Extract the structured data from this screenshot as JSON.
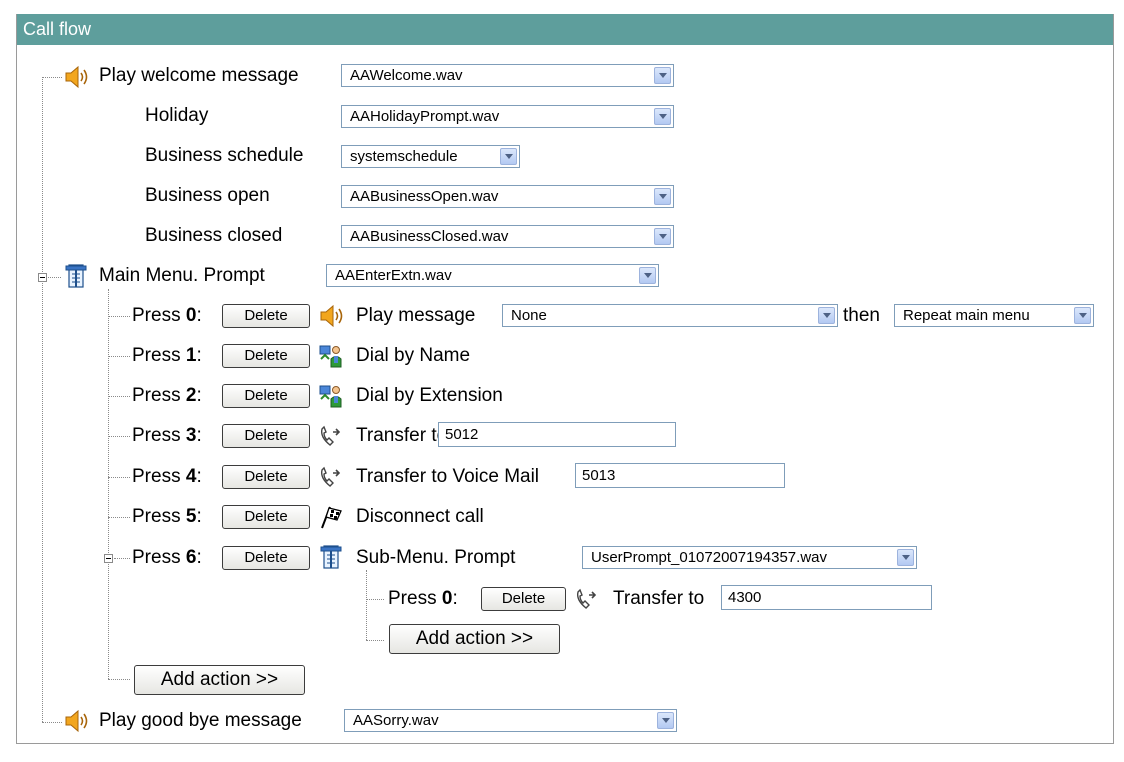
{
  "panel": {
    "title": "Call flow"
  },
  "welcome": {
    "label": "Play welcome message",
    "value": "AAWelcome.wav",
    "holiday_label": "Holiday",
    "holiday_value": "AAHolidayPrompt.wav",
    "schedule_label": "Business schedule",
    "schedule_value": "systemschedule",
    "open_label": "Business open",
    "open_value": "AABusinessOpen.wav",
    "closed_label": "Business closed",
    "closed_value": "AABusinessClosed.wav"
  },
  "main_menu": {
    "label": "Main Menu. Prompt",
    "value": "AAEnterExtn.wav",
    "add_action": "Add action >>",
    "actions": [
      {
        "press": "Press ",
        "key": "0",
        "colon": ":",
        "delete": "Delete",
        "action": "Play message",
        "value": "None",
        "then": "then",
        "then_value": "Repeat main menu"
      },
      {
        "press": "Press ",
        "key": "1",
        "colon": ":",
        "delete": "Delete",
        "action": "Dial by Name"
      },
      {
        "press": "Press ",
        "key": "2",
        "colon": ":",
        "delete": "Delete",
        "action": "Dial by Extension"
      },
      {
        "press": "Press ",
        "key": "3",
        "colon": ":",
        "delete": "Delete",
        "action": "Transfer to",
        "value": "5012"
      },
      {
        "press": "Press ",
        "key": "4",
        "colon": ":",
        "delete": "Delete",
        "action": "Transfer to Voice Mail",
        "value": "5013"
      },
      {
        "press": "Press ",
        "key": "5",
        "colon": ":",
        "delete": "Delete",
        "action": "Disconnect call"
      },
      {
        "press": "Press ",
        "key": "6",
        "colon": ":",
        "delete": "Delete",
        "action": "Sub-Menu. Prompt",
        "value": "UserPrompt_01072007194357.wav"
      }
    ]
  },
  "sub_menu": {
    "add_action": "Add action >>",
    "actions": [
      {
        "press": "Press ",
        "key": "0",
        "colon": ":",
        "delete": "Delete",
        "action": "Transfer to",
        "value": "4300"
      }
    ]
  },
  "goodbye": {
    "label": "Play good bye message",
    "value": "AASorry.wav"
  },
  "icons": {
    "speaker": "speaker-icon",
    "menu": "menu-icon",
    "directory": "directory-icon",
    "transfer": "phone-transfer-icon",
    "disconnect": "disconnect-flag-icon"
  }
}
